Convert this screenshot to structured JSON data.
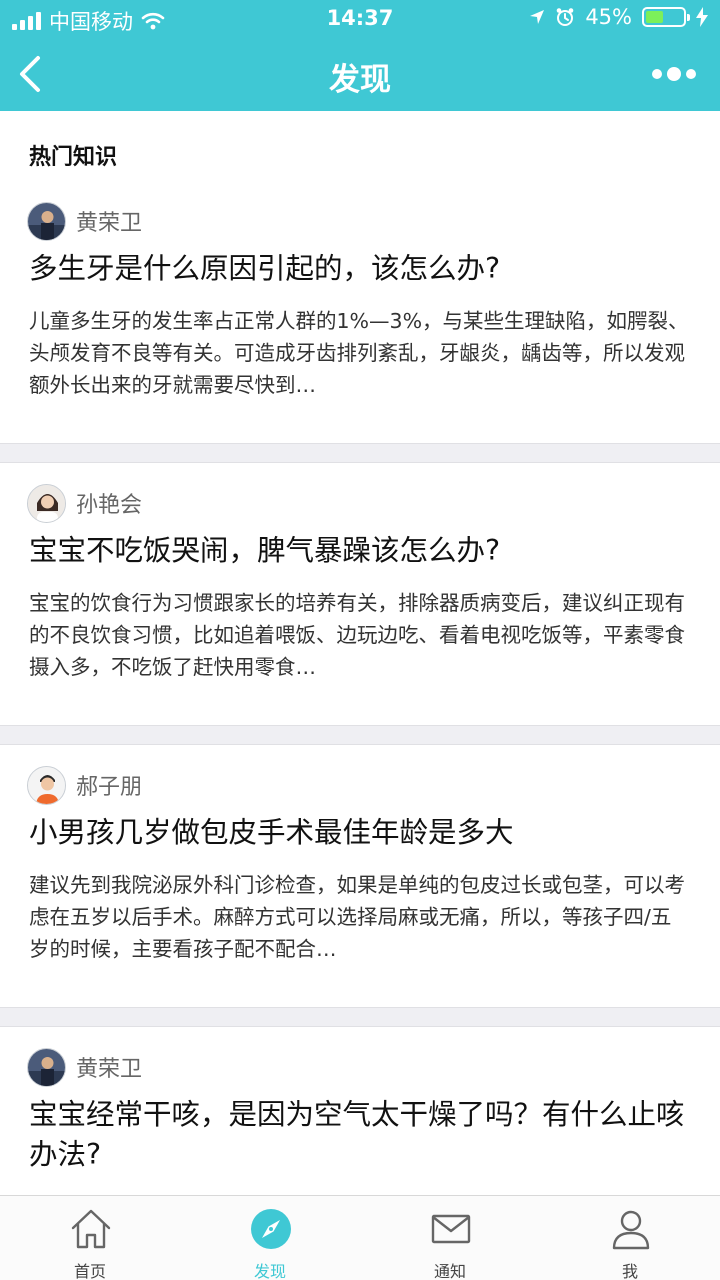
{
  "status_bar": {
    "carrier": "中国移动",
    "time": "14:37",
    "battery": "45%",
    "battery_level": 0.45
  },
  "nav": {
    "title": "发现"
  },
  "section": {
    "title": "热门知识"
  },
  "articles": [
    {
      "author": "黄荣卫",
      "title": "多生牙是什么原因引起的，该怎么办?",
      "excerpt": "儿童多生牙的发生率占正常人群的1%—3%，与某些生理缺陷，如腭裂、头颅发育不良等有关。可造成牙齿排列紊乱，牙龈炎，龋齿等，所以发观额外长出来的牙就需要尽快到…"
    },
    {
      "author": "孙艳会",
      "title": "宝宝不吃饭哭闹，脾气暴躁该怎么办?",
      "excerpt": "宝宝的饮食行为习惯跟家长的培养有关，排除器质病变后，建议纠正现有的不良饮食习惯，比如追着喂饭、边玩边吃、看着电视吃饭等，平素零食摄入多，不吃饭了赶快用零食…"
    },
    {
      "author": "郝子朋",
      "title": "小男孩几岁做包皮手术最佳年龄是多大",
      "excerpt": "建议先到我院泌尿外科门诊检查，如果是单纯的包皮过长或包茎，可以考虑在五岁以后手术。麻醉方式可以选择局麻或无痛，所以，等孩子四/五岁的时候，主要看孩子配不配合…"
    },
    {
      "author": "黄荣卫",
      "title": "宝宝经常干咳，是因为空气太干燥了吗？有什么止咳办法?",
      "excerpt": ""
    }
  ],
  "tabs": [
    {
      "label": "首页",
      "icon": "home-icon"
    },
    {
      "label": "发现",
      "icon": "compass-icon"
    },
    {
      "label": "通知",
      "icon": "mail-icon"
    },
    {
      "label": "我",
      "icon": "user-icon"
    }
  ],
  "colors": {
    "accent": "#3fc8d4",
    "battery_fill": "#7cf05a",
    "divider": "#efeff3"
  }
}
